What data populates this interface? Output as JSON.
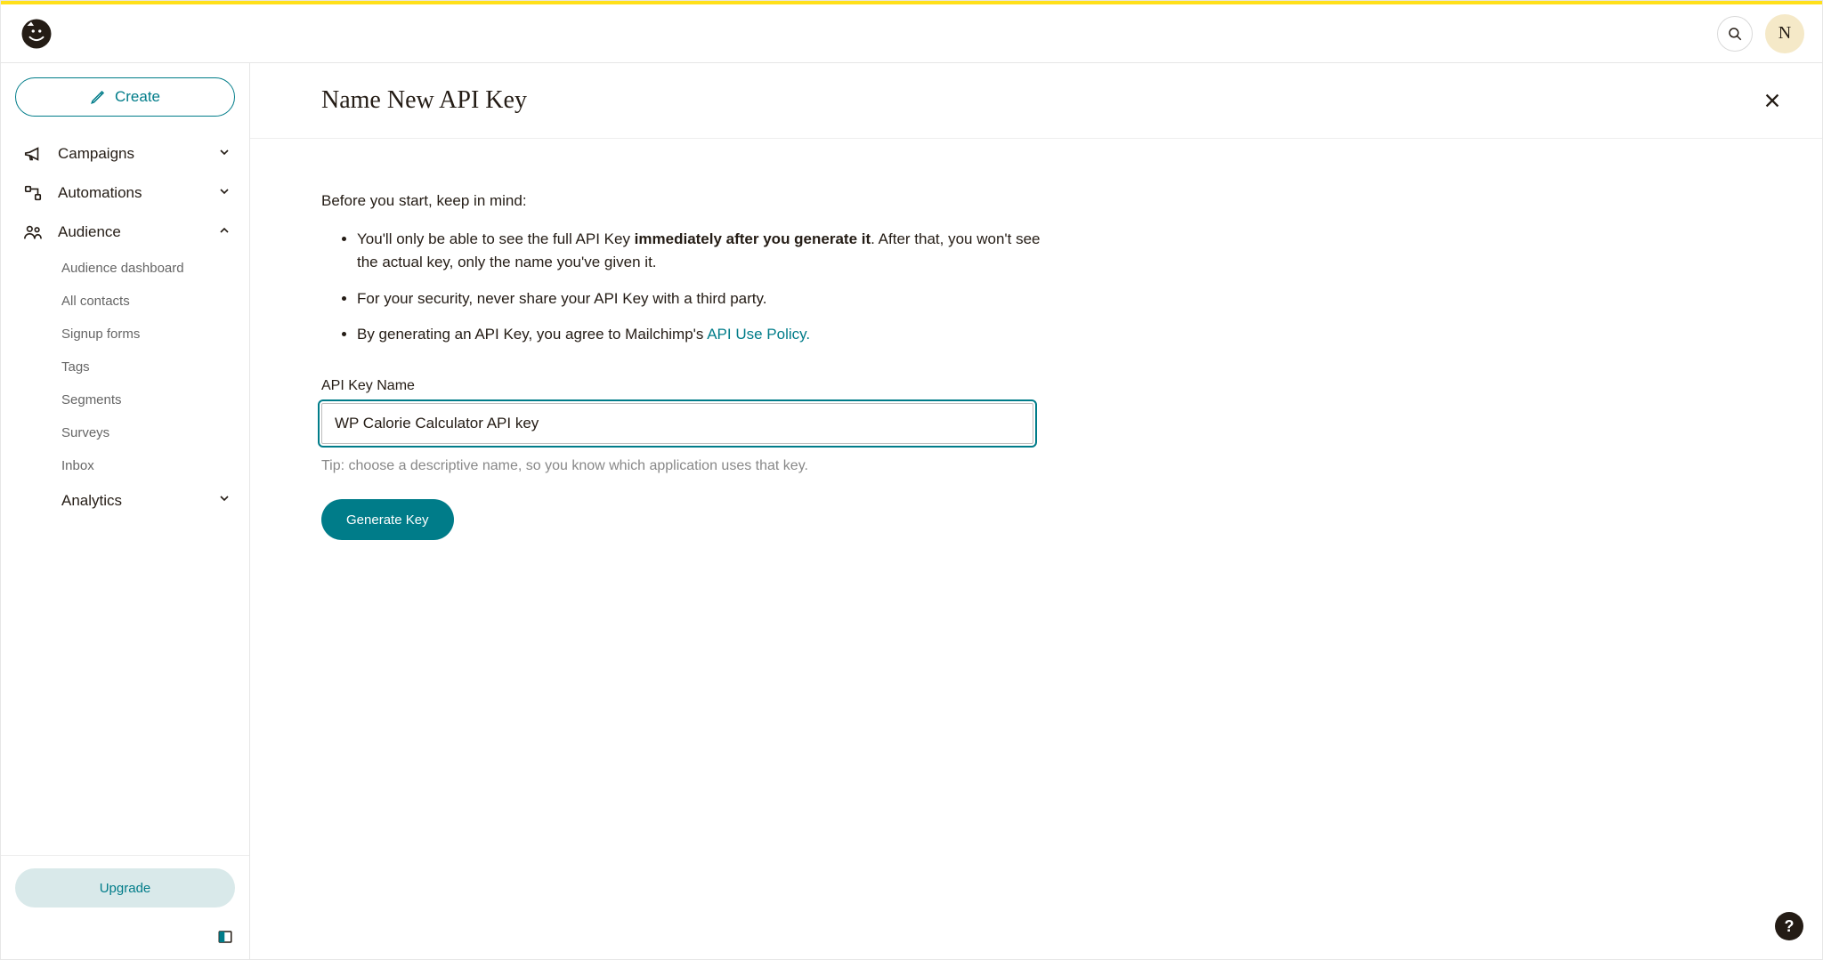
{
  "header": {
    "avatar_initial": "N"
  },
  "sidebar": {
    "create_label": "Create",
    "items": [
      {
        "label": "Campaigns",
        "expanded": false
      },
      {
        "label": "Automations",
        "expanded": false
      },
      {
        "label": "Audience",
        "expanded": true,
        "children": [
          "Audience dashboard",
          "All contacts",
          "Signup forms",
          "Tags",
          "Segments",
          "Surveys",
          "Inbox"
        ]
      },
      {
        "label": "Analytics",
        "expanded": false
      }
    ],
    "upgrade_label": "Upgrade"
  },
  "main": {
    "title": "Name New API Key",
    "intro": "Before you start, keep in mind:",
    "bullets": {
      "b1_pre": "You'll only be able to see the full API Key ",
      "b1_strong": "immediately after you generate it",
      "b1_post": ". After that, you won't see the actual key, only the name you've given it.",
      "b2": "For your security, never share your API Key with a third party.",
      "b3_pre": "By generating an API Key, you agree to Mailchimp's ",
      "b3_link": "API Use Policy."
    },
    "field_label": "API Key Name",
    "input_value": "WP Calorie Calculator API key",
    "tip": "Tip: choose a descriptive name, so you know which application uses that key.",
    "generate_label": "Generate Key"
  },
  "help": {
    "label": "?"
  }
}
